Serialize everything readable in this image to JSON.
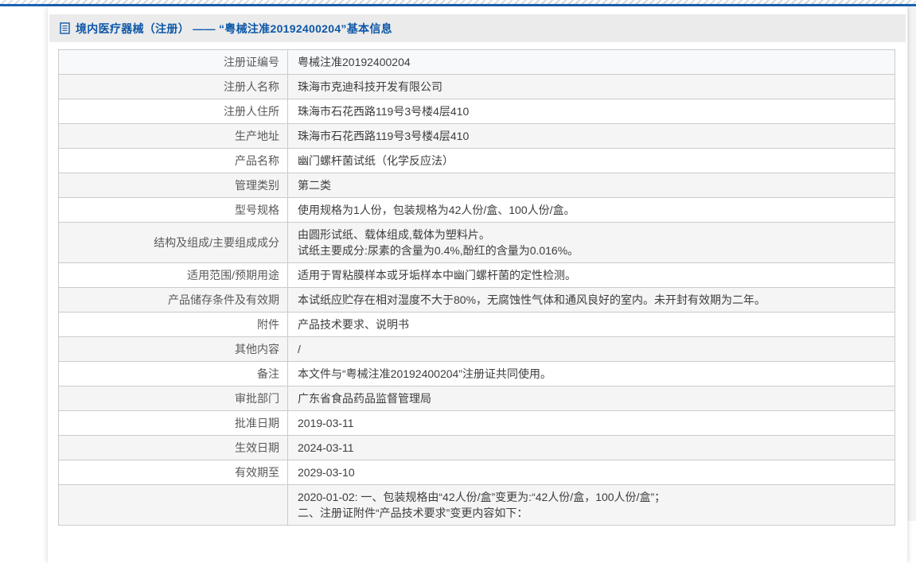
{
  "header": {
    "icon": "document-icon",
    "title": "境内医疗器械（注册） —— “粤械注准20192400204”基本信息"
  },
  "colors": {
    "accent_line_blue": "#1a63b4",
    "title_blue": "#0d57a7",
    "title_bar_bg": "#ebebeb",
    "row_alt_bg": "#f5f5f5",
    "first_row_bg": "#f7f9fb",
    "table_border": "#cbcbcb",
    "label_text": "#5a5a5a",
    "value_text": "#3d3d3d"
  },
  "table": {
    "rows": [
      {
        "label": "注册证编号",
        "lines": [
          "粤械注准20192400204"
        ]
      },
      {
        "label": "注册人名称",
        "lines": [
          "珠海市克迪科技开发有限公司"
        ]
      },
      {
        "label": "注册人住所",
        "lines": [
          "珠海市石花西路119号3号楼4层410"
        ]
      },
      {
        "label": "生产地址",
        "lines": [
          "珠海市石花西路119号3号楼4层410"
        ]
      },
      {
        "label": "产品名称",
        "lines": [
          "幽门螺杆菌试纸（化学反应法）"
        ]
      },
      {
        "label": "管理类别",
        "lines": [
          "第二类"
        ]
      },
      {
        "label": "型号规格",
        "lines": [
          "使用规格为1人份，包装规格为42人份/盒、100人份/盒。"
        ]
      },
      {
        "label": "结构及组成/主要组成成分",
        "lines": [
          "由圆形试纸、载体组成,载体为塑料片。",
          "试纸主要成分:尿素的含量为0.4%,酚红的含量为0.016%。"
        ]
      },
      {
        "label": "适用范围/预期用途",
        "lines": [
          "适用于胃粘膜样本或牙垢样本中幽门螺杆菌的定性检测。"
        ]
      },
      {
        "label": "产品储存条件及有效期",
        "lines": [
          "本试纸应贮存在相对湿度不大于80%，无腐蚀性气体和通风良好的室内。未开封有效期为二年。"
        ]
      },
      {
        "label": "附件",
        "lines": [
          "产品技术要求、说明书"
        ]
      },
      {
        "label": "其他内容",
        "lines": [
          "/"
        ]
      },
      {
        "label": "备注",
        "lines": [
          "本文件与“粤械注准20192400204”注册证共同使用。"
        ]
      },
      {
        "label": "审批部门",
        "lines": [
          "广东省食品药品监督管理局"
        ]
      },
      {
        "label": "批准日期",
        "lines": [
          "2019-03-11"
        ]
      },
      {
        "label": "生效日期",
        "lines": [
          "2024-03-11"
        ]
      },
      {
        "label": "有效期至",
        "lines": [
          "2029-03-10"
        ]
      },
      {
        "label": "",
        "lines": [
          "2020-01-02: 一、包装规格由“42人份/盒”变更为:“42人份/盒，100人份/盒”；",
          "二、注册证附件“产品技术要求”变更内容如下："
        ]
      }
    ]
  }
}
